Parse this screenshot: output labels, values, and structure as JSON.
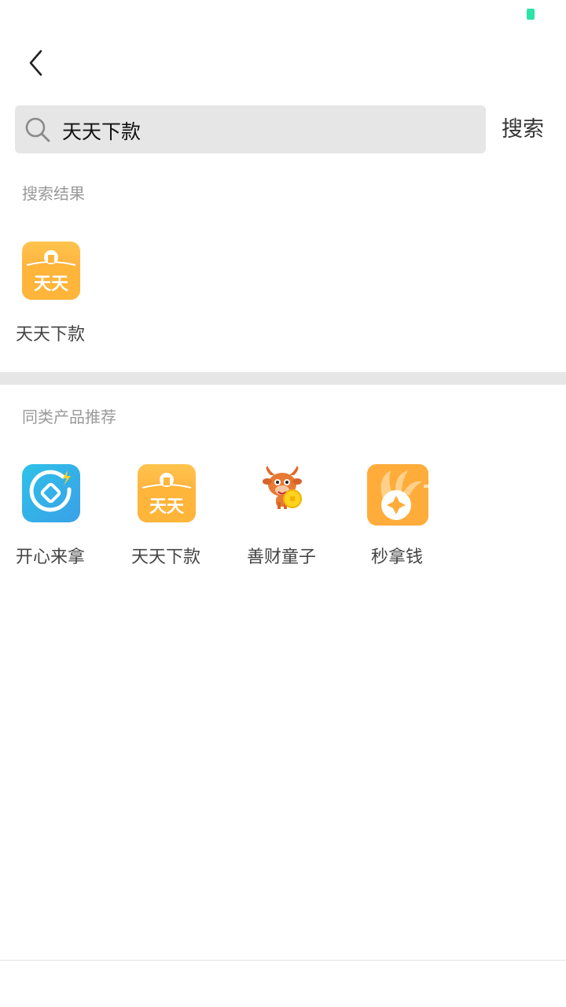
{
  "colors": {
    "battery": "#2de3a6",
    "orange_top": "#ffc44d",
    "orange_bottom": "#ff9f2e",
    "blue_top": "#2ec2e8",
    "blue_bottom": "#3aa0e8",
    "search_bg": "#e6e6e6"
  },
  "header": {
    "back_icon": "chevron-left-icon"
  },
  "search": {
    "value": "天天下款",
    "placeholder": "",
    "button_label": "搜索",
    "icon": "search-icon"
  },
  "results": {
    "title": "搜索结果",
    "items": [
      {
        "label": "天天下款",
        "icon": "tiantian-app-icon"
      }
    ]
  },
  "recommend": {
    "title": "同类产品推荐",
    "items": [
      {
        "label": "开心来拿",
        "icon": "kaixinlaina-app-icon"
      },
      {
        "label": "天天下款",
        "icon": "tiantian-app-icon"
      },
      {
        "label": "善财童子",
        "icon": "shancaitongzi-app-icon"
      },
      {
        "label": "秒拿钱",
        "icon": "miaonaqian-app-icon"
      }
    ]
  },
  "icon_text": {
    "tiantian": "天天"
  }
}
